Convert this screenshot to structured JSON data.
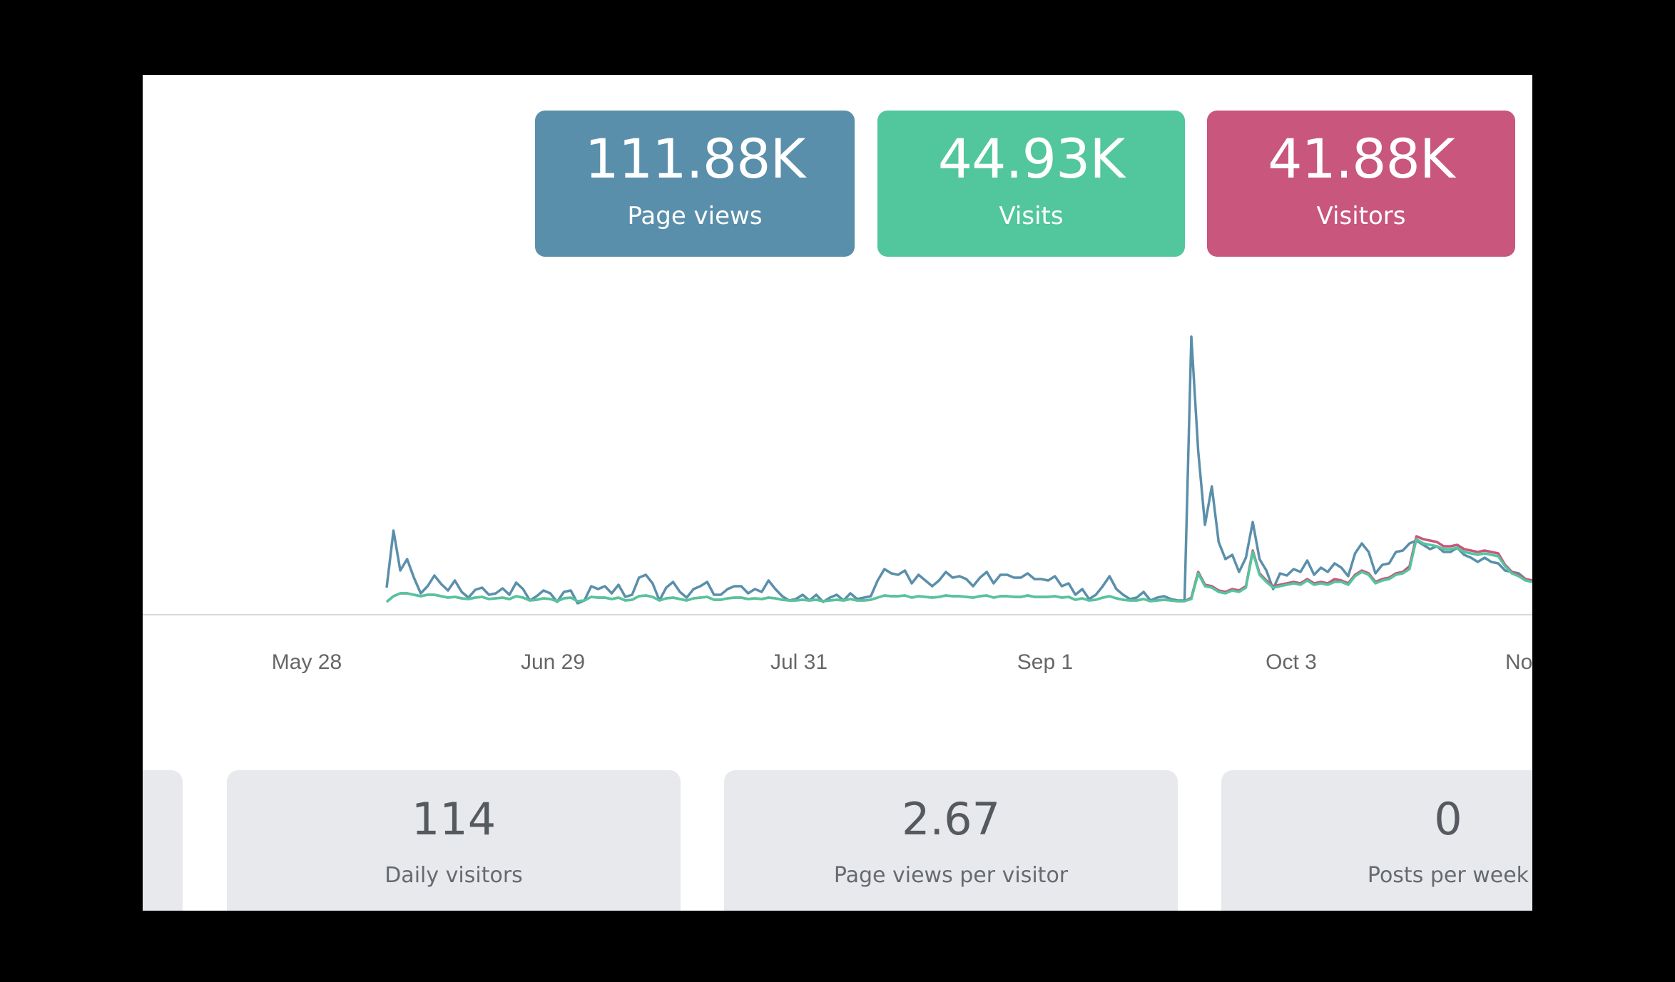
{
  "stats": [
    {
      "value": "111.88K",
      "label": "Page views",
      "color": "#5a8fab"
    },
    {
      "value": "44.93K",
      "label": "Visits",
      "color": "#52c69c"
    },
    {
      "value": "41.88K",
      "label": "Visitors",
      "color": "#c9567c"
    }
  ],
  "summary": {
    "daily_visitors": {
      "value": "114",
      "label": "Daily visitors"
    },
    "page_views_per_visitor": {
      "value": "2.67",
      "label": "Page views per visitor"
    },
    "posts_per_week": {
      "value": "0",
      "label": "Posts per week"
    }
  },
  "chart_data": {
    "type": "line",
    "x_tick_labels": [
      "May 28",
      "Jun 29",
      "Jul 31",
      "Sep 1",
      "Oct 3",
      "No"
    ],
    "grid": false,
    "legend": "none",
    "series": [
      {
        "color": "#5a8fab",
        "values": [
          38,
          118,
          62,
          78,
          52,
          30,
          40,
          55,
          43,
          34,
          48,
          32,
          24,
          35,
          38,
          28,
          30,
          37,
          28,
          45,
          36,
          20,
          26,
          34,
          30,
          18,
          32,
          34,
          16,
          20,
          40,
          36,
          40,
          30,
          42,
          25,
          28,
          52,
          56,
          44,
          20,
          38,
          46,
          32,
          24,
          36,
          40,
          46,
          28,
          28,
          36,
          40,
          40,
          30,
          36,
          32,
          48,
          36,
          26,
          20,
          22,
          28,
          20,
          28,
          18,
          24,
          28,
          20,
          30,
          22,
          24,
          26,
          48,
          64,
          58,
          56,
          62,
          44,
          56,
          48,
          40,
          48,
          60,
          52,
          54,
          50,
          40,
          52,
          60,
          44,
          56,
          56,
          52,
          52,
          58,
          50,
          50,
          48,
          54,
          40,
          44,
          28,
          36,
          22,
          28,
          40,
          54,
          36,
          28,
          22,
          24,
          32,
          20,
          24,
          26,
          22,
          20,
          20,
          390,
          230,
          126,
          180,
          102,
          78,
          84,
          60,
          80,
          130,
          78,
          62,
          36,
          58,
          55,
          64,
          60,
          76,
          56,
          66,
          60,
          72,
          66,
          54,
          86,
          100,
          88,
          58,
          70,
          72,
          88,
          90,
          100,
          104,
          98,
          92,
          96,
          88,
          88,
          94,
          84,
          80,
          74,
          80,
          74,
          72,
          62,
          60,
          58,
          50,
          48
        ],
        "note": ""
      },
      {
        "color": "#c9567c",
        "values": [
          18,
          26,
          30,
          30,
          28,
          26,
          28,
          28,
          26,
          24,
          25,
          23,
          22,
          24,
          25,
          22,
          23,
          24,
          22,
          26,
          24,
          20,
          21,
          23,
          22,
          19,
          23,
          24,
          19,
          20,
          25,
          24,
          24,
          22,
          24,
          20,
          21,
          26,
          27,
          25,
          20,
          23,
          24,
          22,
          20,
          23,
          24,
          25,
          21,
          21,
          23,
          24,
          24,
          22,
          23,
          22,
          24,
          23,
          21,
          20,
          20,
          21,
          20,
          21,
          19,
          20,
          21,
          20,
          22,
          20,
          20,
          21,
          24,
          27,
          26,
          26,
          27,
          24,
          26,
          25,
          24,
          25,
          27,
          26,
          26,
          25,
          24,
          26,
          27,
          24,
          26,
          26,
          25,
          25,
          27,
          25,
          25,
          25,
          26,
          24,
          25,
          21,
          23,
          20,
          21,
          24,
          26,
          23,
          21,
          20,
          20,
          22,
          19,
          20,
          21,
          20,
          19,
          19,
          24,
          60,
          42,
          40,
          34,
          32,
          36,
          34,
          40,
          90,
          58,
          48,
          40,
          42,
          44,
          46,
          44,
          50,
          44,
          46,
          44,
          50,
          48,
          44,
          56,
          62,
          58,
          46,
          50,
          52,
          58,
          60,
          68,
          110,
          106,
          104,
          102,
          96,
          96,
          98,
          92,
          90,
          88,
          90,
          88,
          86,
          70,
          60,
          56,
          50,
          48
        ]
      },
      {
        "color": "#52c69c",
        "values": [
          18,
          26,
          30,
          30,
          28,
          26,
          28,
          28,
          26,
          24,
          25,
          23,
          22,
          24,
          25,
          22,
          23,
          24,
          22,
          26,
          24,
          20,
          21,
          23,
          22,
          19,
          23,
          24,
          19,
          20,
          25,
          24,
          24,
          22,
          24,
          20,
          21,
          26,
          27,
          25,
          20,
          23,
          24,
          22,
          20,
          23,
          24,
          25,
          21,
          21,
          23,
          24,
          24,
          22,
          23,
          22,
          24,
          23,
          21,
          20,
          20,
          21,
          20,
          21,
          19,
          20,
          21,
          20,
          22,
          20,
          20,
          21,
          24,
          27,
          26,
          26,
          27,
          24,
          26,
          25,
          24,
          25,
          27,
          26,
          26,
          25,
          24,
          26,
          27,
          24,
          26,
          26,
          25,
          25,
          27,
          25,
          25,
          25,
          26,
          24,
          25,
          21,
          23,
          20,
          21,
          24,
          26,
          23,
          21,
          20,
          20,
          22,
          19,
          20,
          21,
          20,
          19,
          19,
          22,
          58,
          40,
          38,
          32,
          30,
          34,
          32,
          38,
          88,
          56,
          46,
          38,
          40,
          42,
          44,
          42,
          48,
          42,
          44,
          42,
          46,
          46,
          42,
          54,
          60,
          56,
          44,
          48,
          50,
          56,
          58,
          64,
          106,
          100,
          98,
          96,
          92,
          92,
          94,
          88,
          86,
          84,
          86,
          84,
          82,
          68,
          58,
          54,
          48,
          46
        ]
      }
    ]
  }
}
